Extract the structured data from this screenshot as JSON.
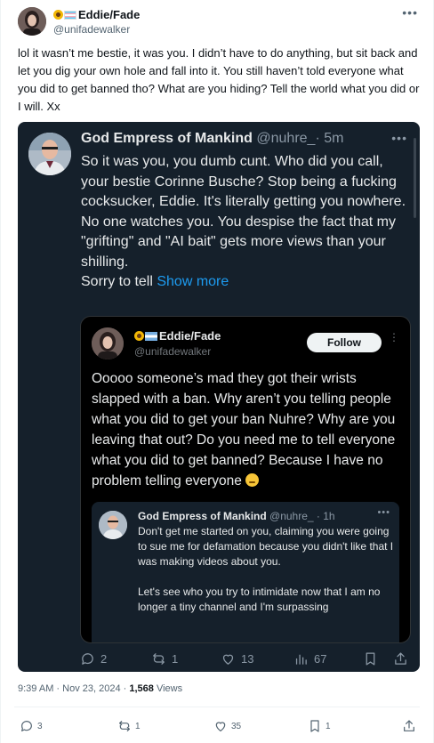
{
  "header": {
    "display_name": "Eddie/Fade",
    "handle": "@unifadewalker",
    "more_icon": "more-horizontal-icon"
  },
  "post": {
    "text": "lol it wasn’t me bestie, it was you. I didn’t have to do anything, but sit back and let you dig your own hole and fall into it. You still haven’t told everyone what you did to get banned tho? What are you hiding? Tell the world what you did or I will. Xx"
  },
  "quoted": {
    "display_name": "God Empress of Mankind",
    "handle": "@nuhre_",
    "time": "· 5m",
    "text": "So it was you, you dumb cunt. Who did you call, your bestie Corinne Busche? Stop being a fucking cocksucker, Eddie. It's literally getting you nowhere.\nNo one watches you. You despise the fact that my \"grifting\" and \"AI bait\" gets more views than your shilling.\nSorry to tell ",
    "show_more": "Show more",
    "nested": {
      "display_name": "Eddie/Fade",
      "handle": "@unifadewalker",
      "follow_label": "Follow",
      "text": "Ooooo someone’s mad they got their wrists slapped with a ban. Why aren’t you telling people what you did to get your ban Nuhre? Why are you leaving that out? Do you need me to tell everyone what you did to get banned? Because I have no problem telling everyone ",
      "third": {
        "display_name": "God Empress of Mankind",
        "handle": "@nuhre_",
        "time": "· 1h",
        "text": "Don't get me started on you, claiming you were going to sue me for defamation because you didn't like that I was making videos about you.\n\nLet's see who you try to intimidate now that I am no longer a tiny channel and I'm surpassing"
      }
    },
    "actions": {
      "replies": "2",
      "reposts": "1",
      "likes": "13",
      "views": "67"
    }
  },
  "meta": {
    "time_date": "9:39 AM · Nov 23, 2024 · ",
    "views_count": "1,568",
    "views_label": " Views"
  },
  "actions": {
    "replies": "3",
    "reposts": "1",
    "likes": "35",
    "bookmarks": "1"
  }
}
